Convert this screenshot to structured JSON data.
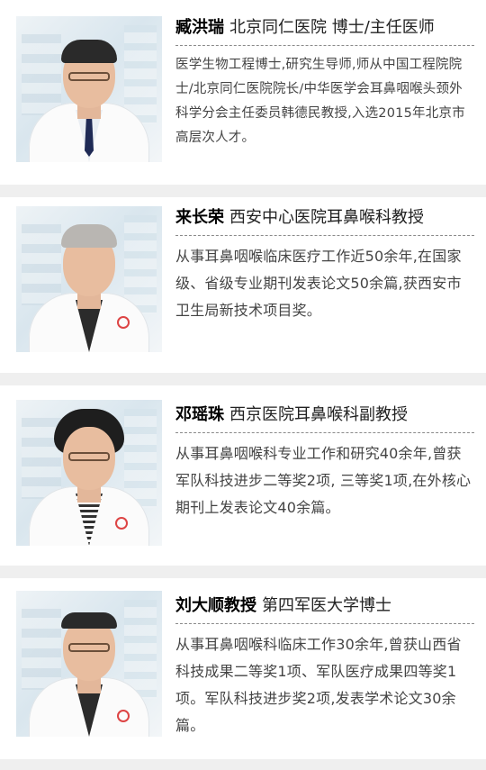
{
  "doctors": [
    {
      "name": "臧洪瑞",
      "title": "北京同仁医院 博士/主任医师",
      "description": "医学生物工程博士,研究生导师,师从中国工程院院士/北京同仁医院院长/中华医学会耳鼻咽喉头颈外科学分会主任委员韩德民教授,入选2015年北京市高层次人才。"
    },
    {
      "name": "来长荣",
      "title": "西安中心医院耳鼻喉科教授",
      "description": "从事耳鼻咽喉临床医疗工作近50余年,在国家级、省级专业期刊发表论文50余篇,获西安市卫生局新技术项目奖。"
    },
    {
      "name": "邓瑶珠",
      "title": "西京医院耳鼻喉科副教授",
      "description": "从事耳鼻咽喉科专业工作和研究40余年,曾获军队科技进步二等奖2项, 三等奖1项,在外核心期刊上发表论文40余篇。"
    },
    {
      "name": "刘大顺教授",
      "title": "第四军医大学博士",
      "description": "从事耳鼻咽喉科临床工作30余年,曾获山西省科技成果二等奖1项、军队医疗成果四等奖1项。军队科技进步奖2项,发表学术论文30余篇。"
    }
  ]
}
